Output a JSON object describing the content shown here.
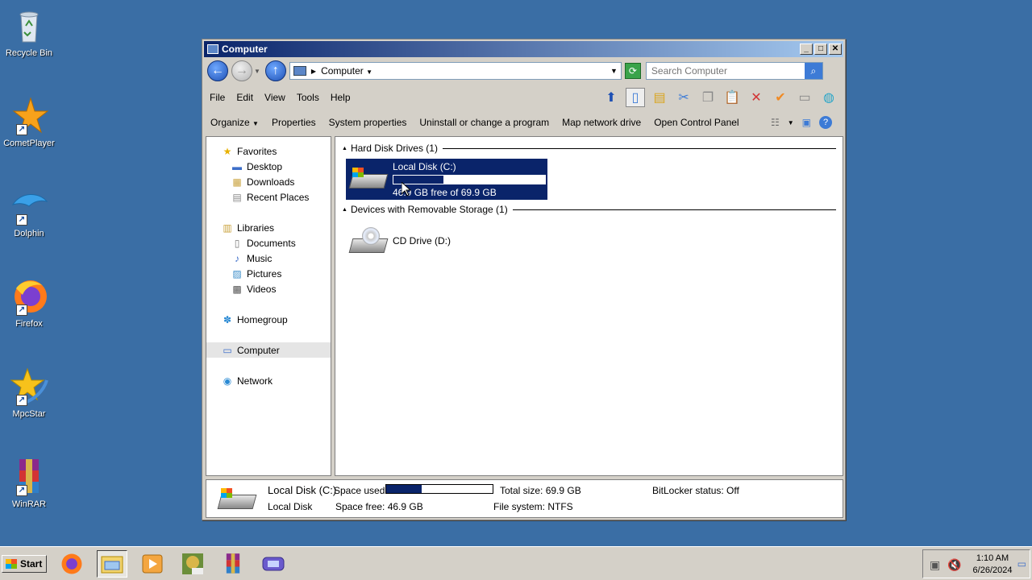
{
  "desktop": {
    "icons": [
      {
        "label": "Recycle Bin"
      },
      {
        "label": "CometPlayer"
      },
      {
        "label": "Dolphin"
      },
      {
        "label": "Firefox"
      },
      {
        "label": "MpcStar"
      },
      {
        "label": "WinRAR"
      }
    ]
  },
  "window": {
    "title": "Computer",
    "address": {
      "crumb": "Computer"
    },
    "search": {
      "placeholder": "Search Computer"
    },
    "menu": [
      "File",
      "Edit",
      "View",
      "Tools",
      "Help"
    ],
    "commands": {
      "organize": "Organize",
      "properties": "Properties",
      "system_properties": "System properties",
      "uninstall": "Uninstall or change a program",
      "map_drive": "Map network drive",
      "control_panel": "Open Control Panel"
    },
    "nav": {
      "favorites": "Favorites",
      "desktop": "Desktop",
      "downloads": "Downloads",
      "recent": "Recent Places",
      "libraries": "Libraries",
      "documents": "Documents",
      "music": "Music",
      "pictures": "Pictures",
      "videos": "Videos",
      "homegroup": "Homegroup",
      "computer": "Computer",
      "network": "Network"
    },
    "groups": {
      "hdd": "Hard Disk Drives (1)",
      "removable": "Devices with Removable Storage (1)"
    },
    "drives": {
      "c": {
        "name": "Local Disk (C:)",
        "free": "46.9 GB free of 69.9 GB",
        "used_fraction": 0.33
      },
      "d": {
        "name": "CD Drive (D:)"
      }
    },
    "details": {
      "name": "Local Disk (C:)",
      "type": "Local Disk",
      "space_used_label": "Space used:",
      "space_free": "Space free: 46.9 GB",
      "total_size": "Total size: 69.9 GB",
      "file_system": "File system: NTFS",
      "bitlocker": "BitLocker status: Off"
    }
  },
  "taskbar": {
    "start": "Start",
    "clock": {
      "time": "1:10 AM",
      "date": "6/26/2024"
    }
  },
  "colors": {
    "desktop": "#3a6ea5",
    "selection": "#0a246a",
    "face": "#d4d0c8"
  }
}
